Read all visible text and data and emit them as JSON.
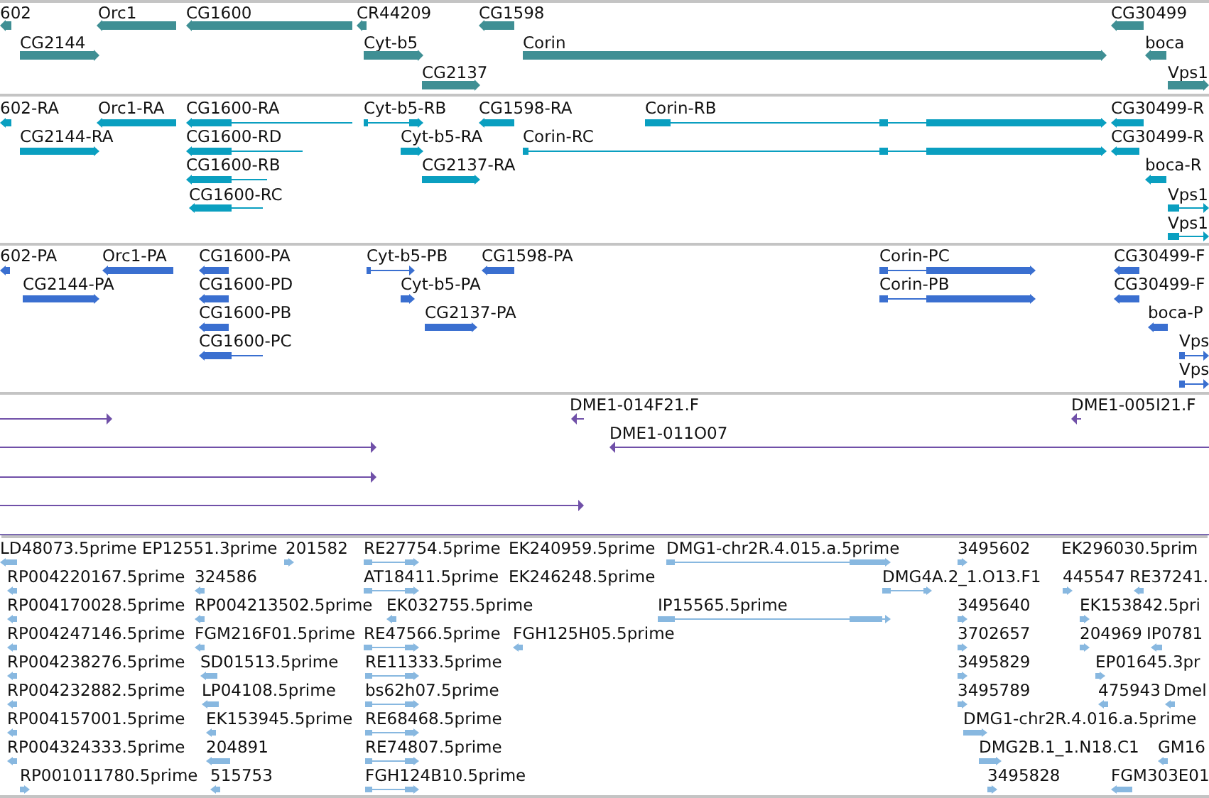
{
  "tracks": [
    {
      "kind": "gene",
      "color": "#3f8f94",
      "features": [
        {
          "label": "602",
          "forward": false
        },
        {
          "label": "Orc1",
          "forward": false
        },
        {
          "label": "CG1600",
          "forward": false
        },
        {
          "label": "CR44209",
          "forward": false
        },
        {
          "label": "CG1598",
          "forward": false
        },
        {
          "label": "CG30499",
          "forward": false
        },
        {
          "label": "CG2144",
          "forward": true
        },
        {
          "label": "Cyt-b5",
          "forward": true
        },
        {
          "label": "Corin",
          "forward": true
        },
        {
          "label": "boca",
          "forward": false
        },
        {
          "label": "CG2137",
          "forward": true
        },
        {
          "label": "Vps1",
          "forward": true
        }
      ]
    },
    {
      "kind": "transcript",
      "color": "#0a9fc0",
      "features": [
        {
          "label": "602-RA",
          "forward": false
        },
        {
          "label": "Orc1-RA",
          "forward": false
        },
        {
          "label": "CG1600-RA",
          "forward": false
        },
        {
          "label": "Cyt-b5-RB",
          "forward": true
        },
        {
          "label": "CG1598-RA",
          "forward": false
        },
        {
          "label": "Corin-RB",
          "forward": true
        },
        {
          "label": "CG30499-R",
          "forward": false
        },
        {
          "label": "CG2144-RA",
          "forward": true
        },
        {
          "label": "CG1600-RD",
          "forward": false
        },
        {
          "label": "Cyt-b5-RA",
          "forward": true
        },
        {
          "label": "Corin-RC",
          "forward": true
        },
        {
          "label": "CG30499-R",
          "forward": false
        },
        {
          "label": "CG1600-RB",
          "forward": false
        },
        {
          "label": "CG2137-RA",
          "forward": true
        },
        {
          "label": "boca-R",
          "forward": false
        },
        {
          "label": "CG1600-RC",
          "forward": false
        },
        {
          "label": "Vps1",
          "forward": true
        },
        {
          "label": "Vps1",
          "forward": true
        }
      ]
    },
    {
      "kind": "protein",
      "color": "#3a6fd0",
      "features": [
        {
          "label": "602-PA",
          "forward": false
        },
        {
          "label": "Orc1-PA",
          "forward": false
        },
        {
          "label": "CG1600-PA",
          "forward": false
        },
        {
          "label": "Cyt-b5-PB",
          "forward": true
        },
        {
          "label": "CG1598-PA",
          "forward": false
        },
        {
          "label": "Corin-PC",
          "forward": true
        },
        {
          "label": "CG30499-F",
          "forward": false
        },
        {
          "label": "CG2144-PA",
          "forward": true
        },
        {
          "label": "CG1600-PD",
          "forward": false
        },
        {
          "label": "Cyt-b5-PA",
          "forward": true
        },
        {
          "label": "Corin-PB",
          "forward": true
        },
        {
          "label": "CG30499-F",
          "forward": false
        },
        {
          "label": "CG1600-PB",
          "forward": false
        },
        {
          "label": "CG2137-PA",
          "forward": true
        },
        {
          "label": "boca-P",
          "forward": false
        },
        {
          "label": "CG1600-PC",
          "forward": false
        },
        {
          "label": "Vps",
          "forward": true
        },
        {
          "label": "Vps",
          "forward": true
        }
      ]
    },
    {
      "kind": "clone",
      "color": "#7050a8",
      "features": [
        {
          "forward": true
        },
        {
          "label": "DME1-014F21.F",
          "forward": false
        },
        {
          "label": "DME1-005I21.F",
          "forward": false
        },
        {
          "forward": true
        },
        {
          "label": "DME1-011O07",
          "forward": false
        },
        {
          "forward": true
        },
        {
          "forward": true
        }
      ]
    },
    {
      "kind": "est",
      "color": "#88b8e0",
      "features": [
        {
          "label": "LD48073.5prime",
          "forward": false
        },
        {
          "label": "EP12551.3prime"
        },
        {
          "label": "201582",
          "forward": true
        },
        {
          "label": "RE27754.5prime",
          "forward": true
        },
        {
          "label": "EK240959.5prime"
        },
        {
          "label": "DMG1-chr2R.4.015.a.5prime",
          "forward": true
        },
        {
          "label": "3495602",
          "forward": true
        },
        {
          "label": "EK296030.5prim"
        },
        {
          "label": "RP004220167.5prime",
          "forward": false
        },
        {
          "label": "324586",
          "forward": false
        },
        {
          "label": "AT18411.5prime",
          "forward": true
        },
        {
          "label": "EK246248.5prime"
        },
        {
          "label": "DMG4A.2_1.O13.F1",
          "forward": true
        },
        {
          "label": "445547",
          "forward": true
        },
        {
          "label": "RE37241.",
          "forward": false
        },
        {
          "label": "RP004170028.5prime",
          "forward": false
        },
        {
          "label": "RP004213502.5prime",
          "forward": false
        },
        {
          "label": "EK032755.5prime",
          "forward": false
        },
        {
          "label": "IP15565.5prime",
          "forward": true
        },
        {
          "label": "3495640",
          "forward": true
        },
        {
          "label": "EK153842.5pri",
          "forward": true
        },
        {
          "label": "RP004247146.5prime",
          "forward": false
        },
        {
          "label": "FGM216F01.5prime",
          "forward": false
        },
        {
          "label": "RE47566.5prime",
          "forward": true
        },
        {
          "label": "FGH125H05.5prime",
          "forward": false
        },
        {
          "label": "3702657",
          "forward": true
        },
        {
          "label": "204969",
          "forward": true
        },
        {
          "label": "IP0781",
          "forward": false
        },
        {
          "label": "RP004238276.5prime",
          "forward": false
        },
        {
          "label": "SD01513.5prime",
          "forward": false
        },
        {
          "label": "RE11333.5prime",
          "forward": true
        },
        {
          "label": "3495829",
          "forward": true
        },
        {
          "label": "EP01645.3pr",
          "forward": true
        },
        {
          "label": "RP004232882.5prime",
          "forward": false
        },
        {
          "label": "LP04108.5prime",
          "forward": false
        },
        {
          "label": "bs62h07.5prime",
          "forward": true
        },
        {
          "label": "3495789",
          "forward": true
        },
        {
          "label": "475943",
          "forward": false
        },
        {
          "label": "Dmel",
          "forward": false
        },
        {
          "label": "RP004157001.5prime",
          "forward": false
        },
        {
          "label": "EK153945.5prime",
          "forward": false
        },
        {
          "label": "RE68468.5prime",
          "forward": true
        },
        {
          "label": "DMG1-chr2R.4.016.a.5prime",
          "forward": true
        },
        {
          "label": "RP004324333.5prime",
          "forward": false
        },
        {
          "label": "204891",
          "forward": false
        },
        {
          "label": "RE74807.5prime",
          "forward": true
        },
        {
          "label": "DMG2B.1_1.N18.C1",
          "forward": true
        },
        {
          "label": "GM16",
          "forward": false
        },
        {
          "label": "RP001011780.5prime",
          "forward": true
        },
        {
          "label": "515753",
          "forward": false
        },
        {
          "label": "FGH124B10.5prime",
          "forward": true
        },
        {
          "label": "3495828",
          "forward": true
        },
        {
          "label": "FGM303E01",
          "forward": false
        }
      ]
    }
  ]
}
